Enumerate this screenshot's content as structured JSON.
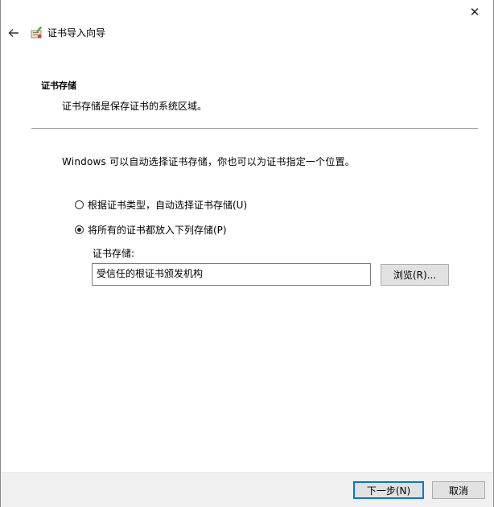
{
  "window": {
    "close_glyph": "✕",
    "title": "证书导入向导"
  },
  "header": {
    "section_title": "证书存储",
    "section_description": "证书存储是保存证书的系统区域。"
  },
  "body": {
    "intro": "Windows 可以自动选择证书存储，你也可以为证书指定一个位置。",
    "options": [
      {
        "label": "根据证书类型，自动选择证书存储(U)",
        "checked": false
      },
      {
        "label": "将所有的证书都放入下列存储(P)",
        "checked": true
      }
    ],
    "store_label": "证书存储:",
    "store_value": "受信任的根证书颁发机构",
    "browse_label": "浏览(R)..."
  },
  "footer": {
    "next_label": "下一步(N)",
    "cancel_label": "取消"
  },
  "colors": {
    "accent": "#0078d7",
    "button_bg": "#e1e1e1",
    "footer_bg": "#f0f0f0"
  },
  "icons": {
    "back": "back-arrow-icon",
    "app": "certificate-icon",
    "close": "close-icon"
  }
}
